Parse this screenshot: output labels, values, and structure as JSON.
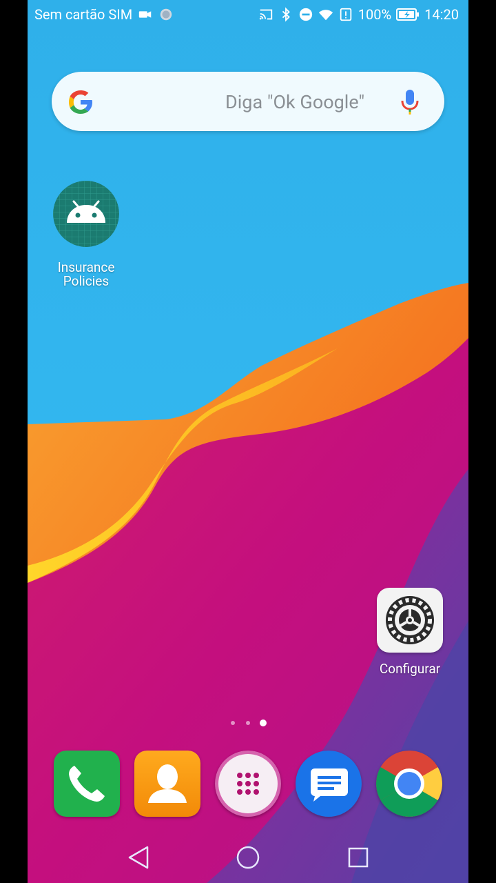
{
  "status_bar": {
    "carrier": "Sem cartão SIM",
    "battery": "100%",
    "time": "14:20"
  },
  "search": {
    "hint": "Diga \"Ok Google\""
  },
  "apps": {
    "insurance_line1": "Insurance",
    "insurance_line2": "Policies",
    "config": "Configurar"
  },
  "pages": {
    "count": 3,
    "current": 3
  },
  "colors": {
    "sky": "#2fb1ec",
    "orange": "#f4781f",
    "magenta": "#c3117c",
    "purple": "#5b3fa2",
    "android_green": "#1f7f73"
  }
}
